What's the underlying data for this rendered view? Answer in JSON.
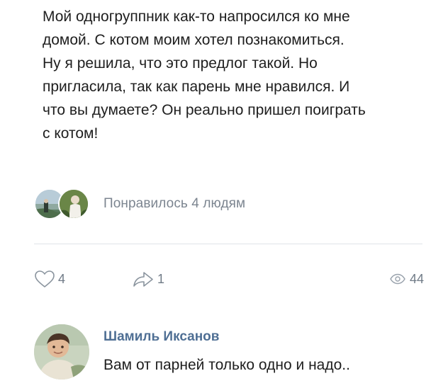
{
  "post": {
    "text": "Мой одногруппник как-то напросился ко мне\nдомой. С котом моим хотел познакомиться.\nНу я решила, что это предлог такой. Но\nпригласила, так как парень мне нравился. И\nчто вы думаете? Он реально пришел поиграть\nс котом!"
  },
  "likes": {
    "label": "Понравилось 4 людям"
  },
  "actions": {
    "likes_count": "4",
    "shares_count": "1",
    "views_count": "44"
  },
  "comment": {
    "author": "Шамиль Иксанов",
    "text": "Вам от парней только одно и надо.."
  },
  "icons": {
    "like": "heart-outline-icon",
    "share": "share-arrow-icon",
    "views": "eye-icon"
  },
  "colors": {
    "author_name": "#4f6f94",
    "muted": "#7c8590",
    "text": "#1e1e1e"
  }
}
